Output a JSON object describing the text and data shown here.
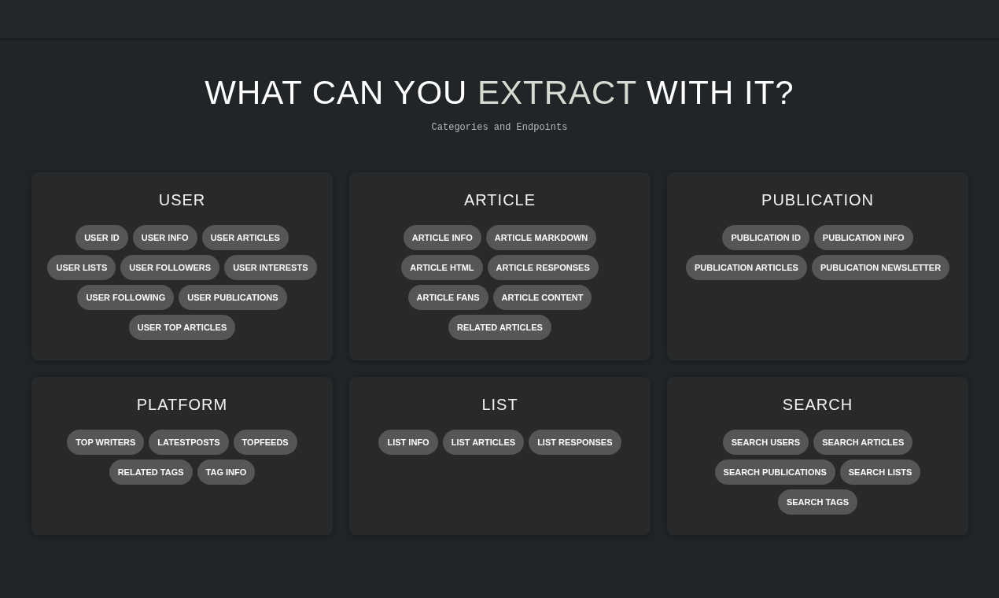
{
  "heading": {
    "before": "WHAT CAN YOU",
    "accent": "EXTRACT",
    "after": "WITH IT?"
  },
  "subtitle": "Categories and Endpoints",
  "categories": [
    {
      "title": "USER",
      "endpoints": [
        "USER ID",
        "USER INFO",
        "USER ARTICLES",
        "USER LISTS",
        "USER FOLLOWERS",
        "USER INTERESTS",
        "USER FOLLOWING",
        "USER PUBLICATIONS",
        "USER TOP ARTICLES"
      ]
    },
    {
      "title": "ARTICLE",
      "endpoints": [
        "ARTICLE INFO",
        "ARTICLE MARKDOWN",
        "ARTICLE HTML",
        "ARTICLE RESPONSES",
        "ARTICLE FANS",
        "ARTICLE CONTENT",
        "RELATED ARTICLES"
      ]
    },
    {
      "title": "PUBLICATION",
      "endpoints": [
        "PUBLICATION ID",
        "PUBLICATION INFO",
        "PUBLICATION ARTICLES",
        "PUBLICATION NEWSLETTER"
      ]
    },
    {
      "title": "PLATFORM",
      "endpoints": [
        "TOP WRITERS",
        "LATESTPOSTS",
        "TOPFEEDS",
        "RELATED TAGS",
        "TAG INFO"
      ]
    },
    {
      "title": "LIST",
      "endpoints": [
        "LIST INFO",
        "LIST ARTICLES",
        "LIST RESPONSES"
      ]
    },
    {
      "title": "SEARCH",
      "endpoints": [
        "SEARCH USERS",
        "SEARCH ARTICLES",
        "SEARCH PUBLICATIONS",
        "SEARCH LISTS",
        "SEARCH TAGS"
      ]
    }
  ]
}
